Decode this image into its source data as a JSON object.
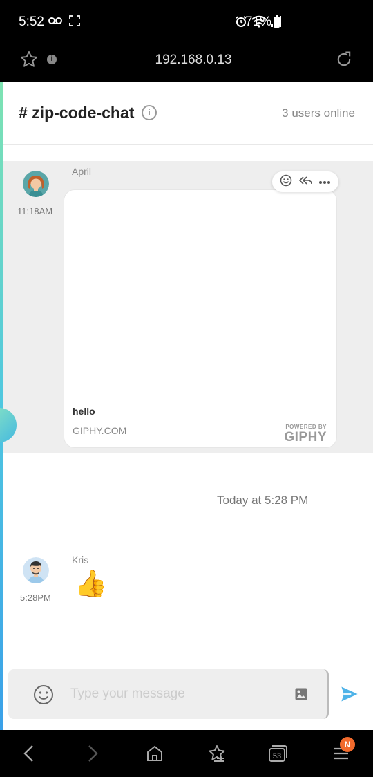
{
  "status_bar": {
    "time": "5:52",
    "battery": "71%",
    "icons": [
      "voicemail-icon",
      "screenshot-icon",
      "alarm-icon",
      "wifi-icon",
      "signal-icon",
      "battery-icon"
    ]
  },
  "browser": {
    "url": "192.168.0.13"
  },
  "channel": {
    "title": "# zip-code-chat",
    "online": "3 users online"
  },
  "messages": [
    {
      "author": "April",
      "time": "11:18AM",
      "giphy": {
        "caption": "hello",
        "source": "GIPHY.COM",
        "powered_by_small": "POWERED BY",
        "powered_by_brand": "GIPHY"
      }
    },
    {
      "author": "Kris",
      "time": "5:28PM",
      "text": "👍"
    }
  ],
  "date_separator": "Today at 5:28 PM",
  "composer": {
    "placeholder": "Type your message"
  },
  "nav": {
    "tabs_count": "53",
    "badge": "N"
  },
  "colors": {
    "accent_send": "#4fb3e8",
    "badge": "#f26a2c",
    "highlight": "#eeeeee"
  }
}
